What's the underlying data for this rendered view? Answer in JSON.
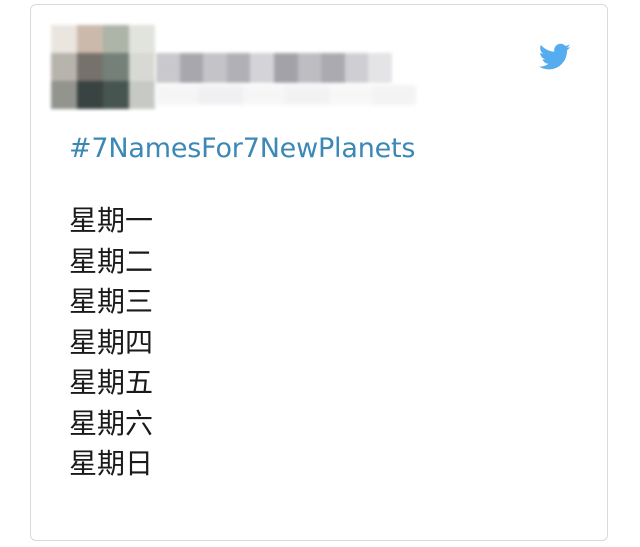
{
  "tweet": {
    "author": {
      "avatar_icon": "blurred-avatar",
      "name_censored": true
    },
    "brand_icon": "twitter-bird-icon",
    "brand_color": "#55acee",
    "hashtag": "#7NamesFor7NewPlanets",
    "hashtag_color": "#3b88b6",
    "lines": [
      "星期一",
      "星期二",
      "星期三",
      "星期四",
      "星期五",
      "星期六",
      "星期日"
    ]
  }
}
